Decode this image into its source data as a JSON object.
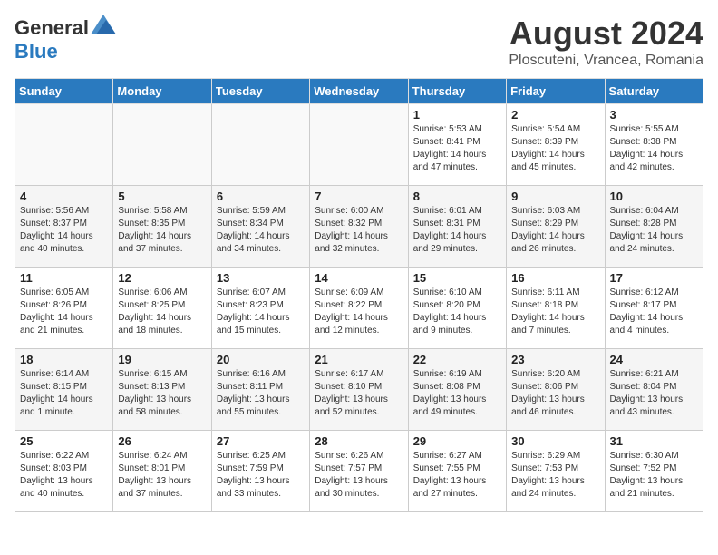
{
  "header": {
    "logo_general": "General",
    "logo_blue": "Blue",
    "month_title": "August 2024",
    "location": "Ploscuteni, Vrancea, Romania"
  },
  "weekdays": [
    "Sunday",
    "Monday",
    "Tuesday",
    "Wednesday",
    "Thursday",
    "Friday",
    "Saturday"
  ],
  "weeks": [
    [
      {
        "num": "",
        "info": ""
      },
      {
        "num": "",
        "info": ""
      },
      {
        "num": "",
        "info": ""
      },
      {
        "num": "",
        "info": ""
      },
      {
        "num": "1",
        "info": "Sunrise: 5:53 AM\nSunset: 8:41 PM\nDaylight: 14 hours\nand 47 minutes."
      },
      {
        "num": "2",
        "info": "Sunrise: 5:54 AM\nSunset: 8:39 PM\nDaylight: 14 hours\nand 45 minutes."
      },
      {
        "num": "3",
        "info": "Sunrise: 5:55 AM\nSunset: 8:38 PM\nDaylight: 14 hours\nand 42 minutes."
      }
    ],
    [
      {
        "num": "4",
        "info": "Sunrise: 5:56 AM\nSunset: 8:37 PM\nDaylight: 14 hours\nand 40 minutes."
      },
      {
        "num": "5",
        "info": "Sunrise: 5:58 AM\nSunset: 8:35 PM\nDaylight: 14 hours\nand 37 minutes."
      },
      {
        "num": "6",
        "info": "Sunrise: 5:59 AM\nSunset: 8:34 PM\nDaylight: 14 hours\nand 34 minutes."
      },
      {
        "num": "7",
        "info": "Sunrise: 6:00 AM\nSunset: 8:32 PM\nDaylight: 14 hours\nand 32 minutes."
      },
      {
        "num": "8",
        "info": "Sunrise: 6:01 AM\nSunset: 8:31 PM\nDaylight: 14 hours\nand 29 minutes."
      },
      {
        "num": "9",
        "info": "Sunrise: 6:03 AM\nSunset: 8:29 PM\nDaylight: 14 hours\nand 26 minutes."
      },
      {
        "num": "10",
        "info": "Sunrise: 6:04 AM\nSunset: 8:28 PM\nDaylight: 14 hours\nand 24 minutes."
      }
    ],
    [
      {
        "num": "11",
        "info": "Sunrise: 6:05 AM\nSunset: 8:26 PM\nDaylight: 14 hours\nand 21 minutes."
      },
      {
        "num": "12",
        "info": "Sunrise: 6:06 AM\nSunset: 8:25 PM\nDaylight: 14 hours\nand 18 minutes."
      },
      {
        "num": "13",
        "info": "Sunrise: 6:07 AM\nSunset: 8:23 PM\nDaylight: 14 hours\nand 15 minutes."
      },
      {
        "num": "14",
        "info": "Sunrise: 6:09 AM\nSunset: 8:22 PM\nDaylight: 14 hours\nand 12 minutes."
      },
      {
        "num": "15",
        "info": "Sunrise: 6:10 AM\nSunset: 8:20 PM\nDaylight: 14 hours\nand 9 minutes."
      },
      {
        "num": "16",
        "info": "Sunrise: 6:11 AM\nSunset: 8:18 PM\nDaylight: 14 hours\nand 7 minutes."
      },
      {
        "num": "17",
        "info": "Sunrise: 6:12 AM\nSunset: 8:17 PM\nDaylight: 14 hours\nand 4 minutes."
      }
    ],
    [
      {
        "num": "18",
        "info": "Sunrise: 6:14 AM\nSunset: 8:15 PM\nDaylight: 14 hours\nand 1 minute."
      },
      {
        "num": "19",
        "info": "Sunrise: 6:15 AM\nSunset: 8:13 PM\nDaylight: 13 hours\nand 58 minutes."
      },
      {
        "num": "20",
        "info": "Sunrise: 6:16 AM\nSunset: 8:11 PM\nDaylight: 13 hours\nand 55 minutes."
      },
      {
        "num": "21",
        "info": "Sunrise: 6:17 AM\nSunset: 8:10 PM\nDaylight: 13 hours\nand 52 minutes."
      },
      {
        "num": "22",
        "info": "Sunrise: 6:19 AM\nSunset: 8:08 PM\nDaylight: 13 hours\nand 49 minutes."
      },
      {
        "num": "23",
        "info": "Sunrise: 6:20 AM\nSunset: 8:06 PM\nDaylight: 13 hours\nand 46 minutes."
      },
      {
        "num": "24",
        "info": "Sunrise: 6:21 AM\nSunset: 8:04 PM\nDaylight: 13 hours\nand 43 minutes."
      }
    ],
    [
      {
        "num": "25",
        "info": "Sunrise: 6:22 AM\nSunset: 8:03 PM\nDaylight: 13 hours\nand 40 minutes."
      },
      {
        "num": "26",
        "info": "Sunrise: 6:24 AM\nSunset: 8:01 PM\nDaylight: 13 hours\nand 37 minutes."
      },
      {
        "num": "27",
        "info": "Sunrise: 6:25 AM\nSunset: 7:59 PM\nDaylight: 13 hours\nand 33 minutes."
      },
      {
        "num": "28",
        "info": "Sunrise: 6:26 AM\nSunset: 7:57 PM\nDaylight: 13 hours\nand 30 minutes."
      },
      {
        "num": "29",
        "info": "Sunrise: 6:27 AM\nSunset: 7:55 PM\nDaylight: 13 hours\nand 27 minutes."
      },
      {
        "num": "30",
        "info": "Sunrise: 6:29 AM\nSunset: 7:53 PM\nDaylight: 13 hours\nand 24 minutes."
      },
      {
        "num": "31",
        "info": "Sunrise: 6:30 AM\nSunset: 7:52 PM\nDaylight: 13 hours\nand 21 minutes."
      }
    ]
  ]
}
